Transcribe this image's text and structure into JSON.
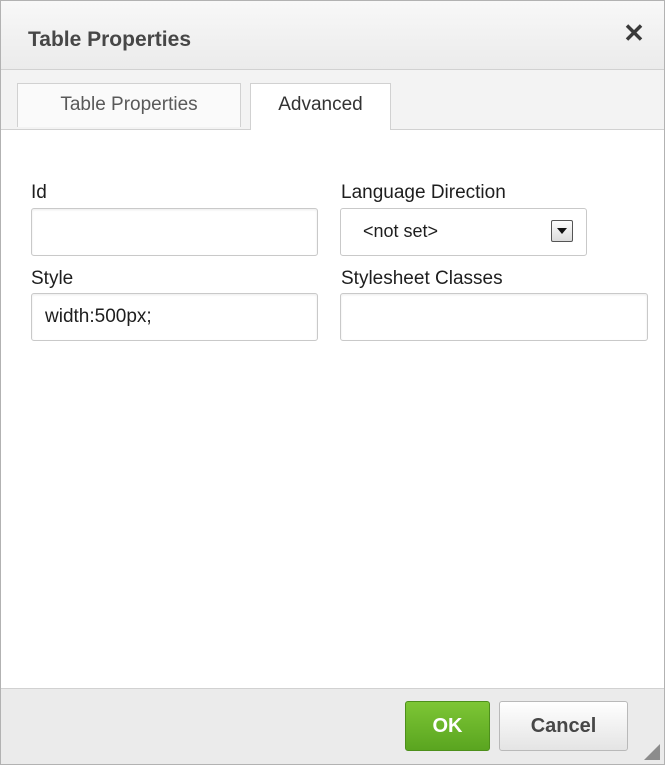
{
  "dialog": {
    "title": "Table Properties",
    "close_glyph": "✕"
  },
  "tabs": [
    {
      "label": "Table Properties",
      "active": false
    },
    {
      "label": "Advanced",
      "active": true
    }
  ],
  "fields": {
    "id": {
      "label": "Id",
      "value": ""
    },
    "language_direction": {
      "label": "Language Direction",
      "value": "<not set>"
    },
    "style": {
      "label": "Style",
      "value": "width:500px;"
    },
    "stylesheet_classes": {
      "label": "Stylesheet Classes",
      "value": ""
    }
  },
  "footer": {
    "ok_label": "OK",
    "cancel_label": "Cancel"
  },
  "colors": {
    "ok_button": "#6cb52c",
    "accent_border": "#d1d1d1"
  },
  "icons": {
    "close": "close-icon",
    "select_arrow": "chevron-down-icon",
    "resize": "resize-handle-icon"
  }
}
